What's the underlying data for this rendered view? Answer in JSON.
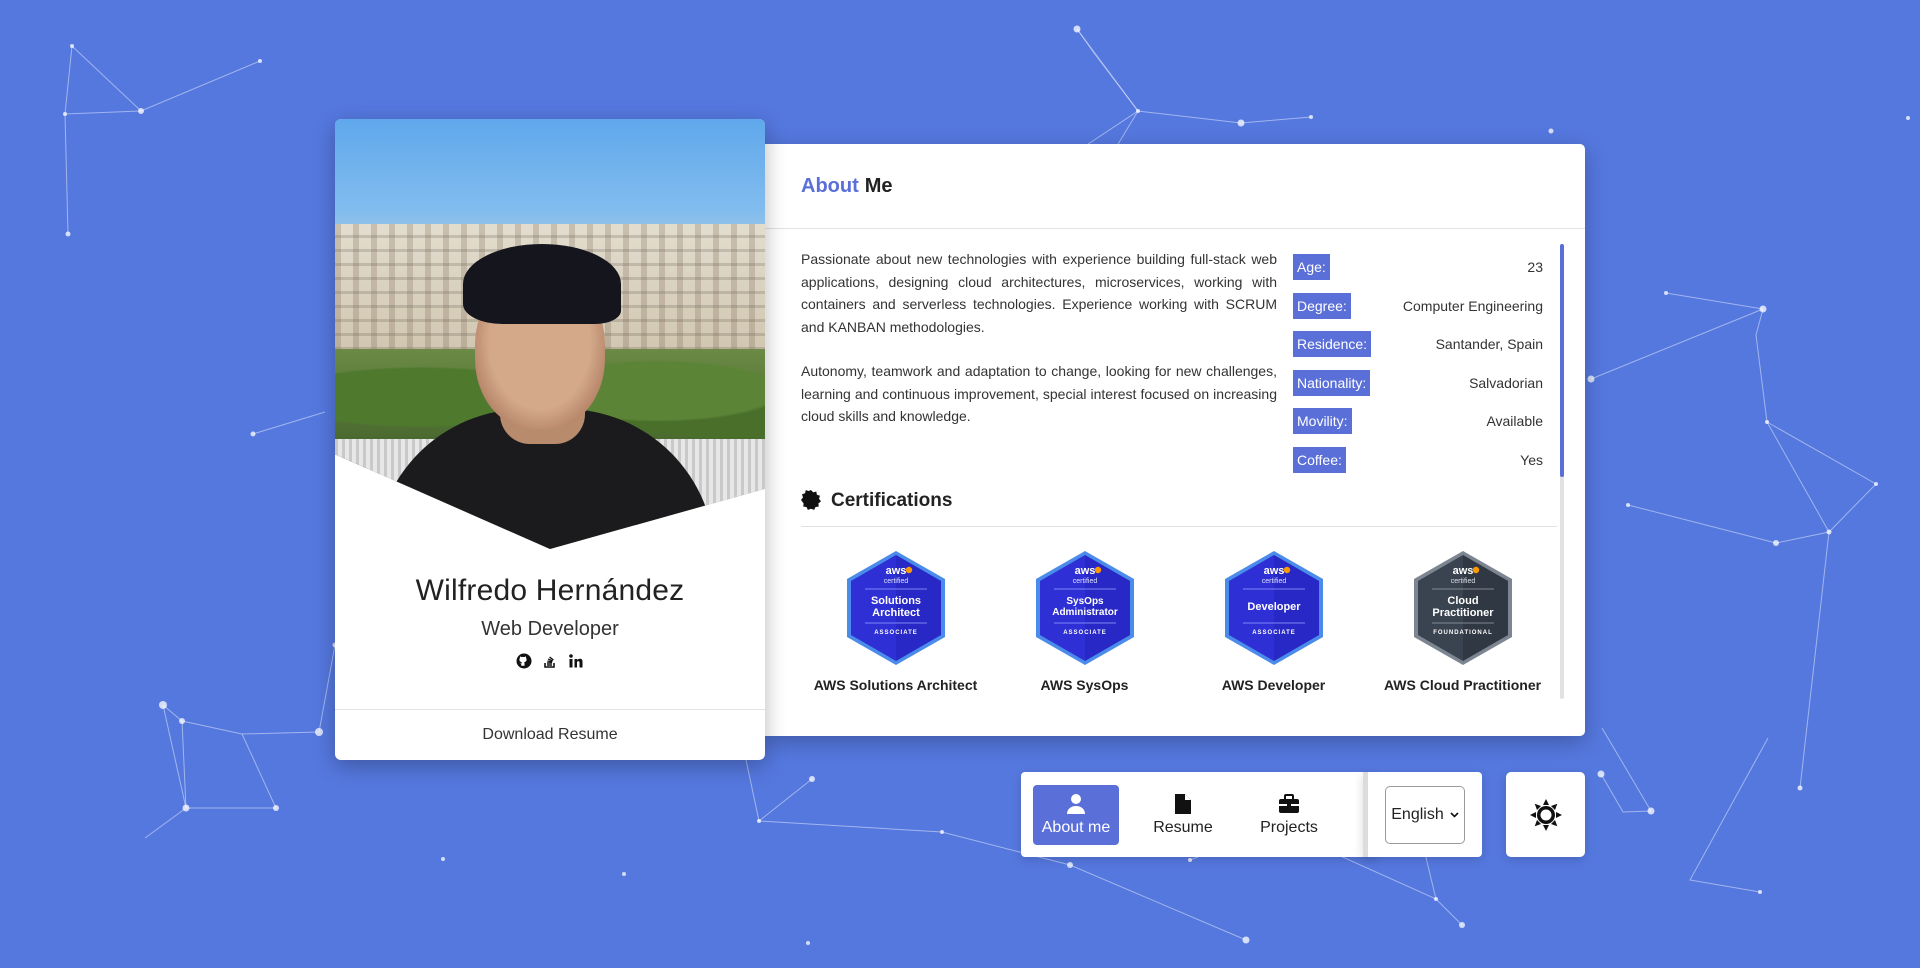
{
  "profile": {
    "name": "Wilfredo Hernández",
    "role": "Web Developer",
    "social": [
      {
        "icon": "github-icon",
        "glyph": "◉"
      },
      {
        "icon": "stackoverflow-icon",
        "glyph": "≡"
      },
      {
        "icon": "linkedin-icon",
        "glyph": "in"
      }
    ],
    "download_label": "Download Resume"
  },
  "about": {
    "title_accent": "About",
    "title_rest": "Me",
    "bio": [
      "Passionate about new technologies with experience building full-stack web applications, designing cloud architectures, microservices, working with containers and serverless technologies. Experience working with SCRUM and KANBAN methodologies.",
      "Autonomy, teamwork and adaptation to change, looking for new challenges, learning and continuous improvement, special interest focused on increasing cloud skills and knowledge."
    ],
    "facts": [
      {
        "label": "Age:",
        "value": "23"
      },
      {
        "label": "Degree:",
        "value": "Computer Engineering"
      },
      {
        "label": "Residence:",
        "value": "Santander, Spain"
      },
      {
        "label": "Nationality:",
        "value": "Salvadorian"
      },
      {
        "label": "Movility:",
        "value": "Available"
      },
      {
        "label": "Coffee:",
        "value": "Yes"
      }
    ]
  },
  "certifications": {
    "title": "Certifications",
    "items": [
      {
        "label": "AWS Solutions Architect",
        "badge_lines": [
          "Solutions",
          "Architect"
        ],
        "level": "ASSOCIATE",
        "color": "#2f2fd6"
      },
      {
        "label": "AWS SysOps",
        "badge_lines": [
          "SysOps",
          "Administrator"
        ],
        "level": "ASSOCIATE",
        "color": "#2f2fd6"
      },
      {
        "label": "AWS Developer",
        "badge_lines": [
          "Developer"
        ],
        "level": "ASSOCIATE",
        "color": "#2f2fd6"
      },
      {
        "label": "AWS Cloud Practitioner",
        "badge_lines": [
          "Cloud",
          "Practitioner"
        ],
        "level": "FOUNDATIONAL",
        "color": "#3a4350"
      }
    ],
    "badge_brand": "aws",
    "badge_sub": "certified"
  },
  "nav": {
    "tabs": [
      {
        "label": "About me",
        "icon": "user-icon",
        "active": true
      },
      {
        "label": "Resume",
        "icon": "file-icon",
        "active": false
      },
      {
        "label": "Projects",
        "icon": "briefcase-icon",
        "active": false
      }
    ],
    "language": "English",
    "theme_icon": "sun-icon"
  },
  "colors": {
    "background": "#5578df",
    "accent": "#5a6fd8"
  }
}
